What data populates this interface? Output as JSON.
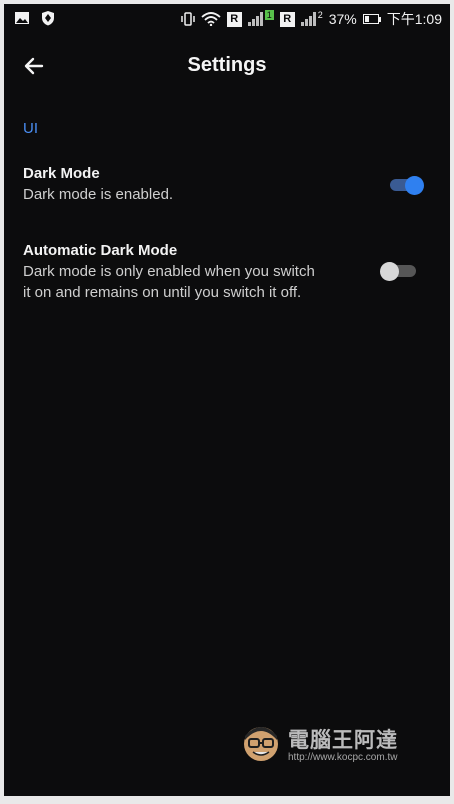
{
  "status_bar": {
    "battery": "37%",
    "time": "下午1:09",
    "sim1_label": "R",
    "sim1_slot": "1",
    "sim2_label": "R",
    "sim2_slot": "2",
    "icons": [
      "gallery-icon",
      "shield-icon",
      "vibrate-icon",
      "wifi-icon",
      "signal-icon",
      "signal-icon",
      "battery-icon"
    ]
  },
  "app_bar": {
    "back_icon": "arrow-left-icon",
    "title": "Settings"
  },
  "settings": {
    "section_header": "UI",
    "items": [
      {
        "title": "Dark Mode",
        "description": "Dark mode is enabled.",
        "enabled": true
      },
      {
        "title": "Automatic Dark Mode",
        "description_line1": "Dark mode is only enabled when you switch",
        "description_line2": "it on and remains on until you switch it off.",
        "enabled": false
      }
    ]
  },
  "watermark": {
    "brand": "電腦王阿達",
    "url": "http://www.kocpc.com.tw"
  },
  "colors": {
    "background": "#0c0c0d",
    "accent": "#2f80f0",
    "section_header": "#4a8ef2"
  }
}
